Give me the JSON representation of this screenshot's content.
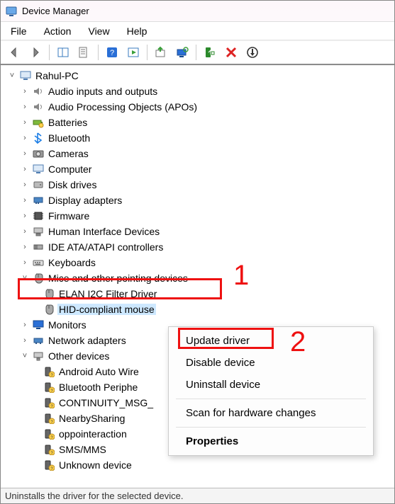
{
  "window": {
    "title": "Device Manager"
  },
  "menu": {
    "file": "File",
    "action": "Action",
    "view": "View",
    "help": "Help"
  },
  "root": {
    "label": "Rahul-PC"
  },
  "tree": {
    "audio_io": "Audio inputs and outputs",
    "audio_apo": "Audio Processing Objects (APOs)",
    "batteries": "Batteries",
    "bluetooth": "Bluetooth",
    "cameras": "Cameras",
    "computer": "Computer",
    "disk_drives": "Disk drives",
    "display_adapters": "Display adapters",
    "firmware": "Firmware",
    "hid": "Human Interface Devices",
    "ide": "IDE ATA/ATAPI controllers",
    "keyboards": "Keyboards",
    "mice": "Mice and other pointing devices",
    "mice_children": {
      "elan": "ELAN I2C Filter Driver",
      "hid_mouse": "HID-compliant mouse"
    },
    "monitors": "Monitors",
    "network": "Network adapters",
    "other": "Other devices",
    "other_children": {
      "android_auto": "Android Auto Wire",
      "bt_periph": "Bluetooth Periphe",
      "continuity": "CONTINUITY_MSG_",
      "nearby": "NearbySharing",
      "oppo": "oppointeraction",
      "smsmms": "SMS/MMS",
      "unknown": "Unknown device"
    }
  },
  "context_menu": {
    "update": "Update driver",
    "disable": "Disable device",
    "uninstall": "Uninstall device",
    "scan": "Scan for hardware changes",
    "properties": "Properties"
  },
  "annotations": {
    "one": "1",
    "two": "2"
  },
  "statusbar": {
    "text": "Uninstalls the driver for the selected device."
  }
}
